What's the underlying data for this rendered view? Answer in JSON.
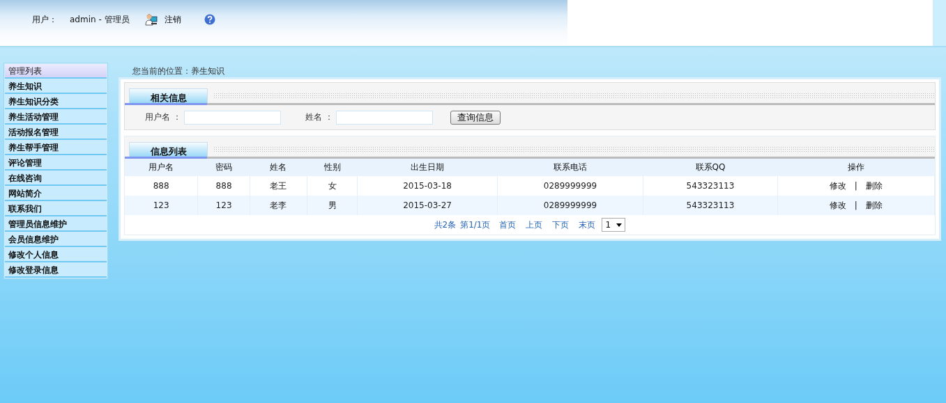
{
  "header": {
    "user_label": "用户：",
    "user_value": "admin - 管理员",
    "logout": "注销"
  },
  "sidebar": {
    "title": "管理列表",
    "items": [
      {
        "label": "养生知识"
      },
      {
        "label": "养生知识分类"
      },
      {
        "label": "养生活动管理"
      },
      {
        "label": "活动报名管理"
      },
      {
        "label": "养生帮手管理"
      },
      {
        "label": "评论管理"
      },
      {
        "label": "在线咨询"
      },
      {
        "label": "网站简介"
      },
      {
        "label": "联系我们"
      },
      {
        "label": "管理员信息维护"
      },
      {
        "label": "会员信息维护"
      },
      {
        "label": "修改个人信息"
      },
      {
        "label": "修改登录信息"
      }
    ]
  },
  "breadcrumb": "您当前的位置：养生知识",
  "search_section": {
    "title": "相关信息",
    "fields": [
      {
        "label": "用户名 ："
      },
      {
        "label": "姓名 ："
      }
    ],
    "button": "查询信息"
  },
  "list_section": {
    "title": "信息列表"
  },
  "table": {
    "columns": [
      "用户名",
      "密码",
      "姓名",
      "性别",
      "出生日期",
      "联系电话",
      "联系QQ",
      "操作"
    ],
    "rows": [
      {
        "cells": [
          "888",
          "888",
          "老王",
          "女",
          "2015-03-18",
          "0289999999",
          "543323113"
        ],
        "actions": [
          "修改",
          "|",
          "删除"
        ]
      },
      {
        "cells": [
          "123",
          "123",
          "老李",
          "男",
          "2015-03-27",
          "0289999999",
          "543323113"
        ],
        "actions": [
          "修改",
          "|",
          "删除"
        ]
      }
    ]
  },
  "pagination": {
    "total": "共2条",
    "page": "第1/1页",
    "links": [
      "首页",
      "上页",
      "下页",
      "末页"
    ],
    "select": "1"
  }
}
